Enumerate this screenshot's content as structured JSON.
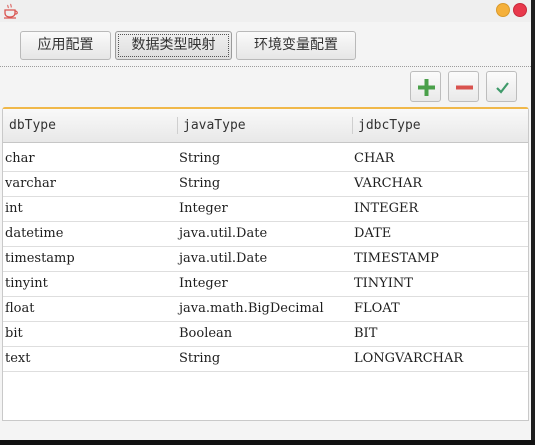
{
  "window": {
    "accent_close": "#e8394c",
    "accent_minimize": "#f5b03a",
    "app_icon": "java-coffee-cup-icon"
  },
  "tabs": [
    {
      "label": "应用配置"
    },
    {
      "label": "数据类型映射",
      "selected": true
    },
    {
      "label": "环境变量配置"
    }
  ],
  "toolbar": {
    "add_icon": "plus-icon",
    "remove_icon": "minus-icon",
    "save_icon": "check-icon"
  },
  "table": {
    "columns": [
      "dbType",
      "javaType",
      "jdbcType"
    ],
    "rows": [
      [
        "char",
        "String",
        "CHAR"
      ],
      [
        "varchar",
        "String",
        "VARCHAR"
      ],
      [
        "int",
        "Integer",
        "INTEGER"
      ],
      [
        "datetime",
        "java.util.Date",
        "DATE"
      ],
      [
        "timestamp",
        "java.util.Date",
        "TIMESTAMP"
      ],
      [
        "tinyint",
        "Integer",
        "TINYINT"
      ],
      [
        "float",
        "java.math.BigDecimal",
        "FLOAT"
      ],
      [
        "bit",
        "Boolean",
        "BIT"
      ],
      [
        "text",
        "String",
        "LONGVARCHAR"
      ]
    ]
  }
}
